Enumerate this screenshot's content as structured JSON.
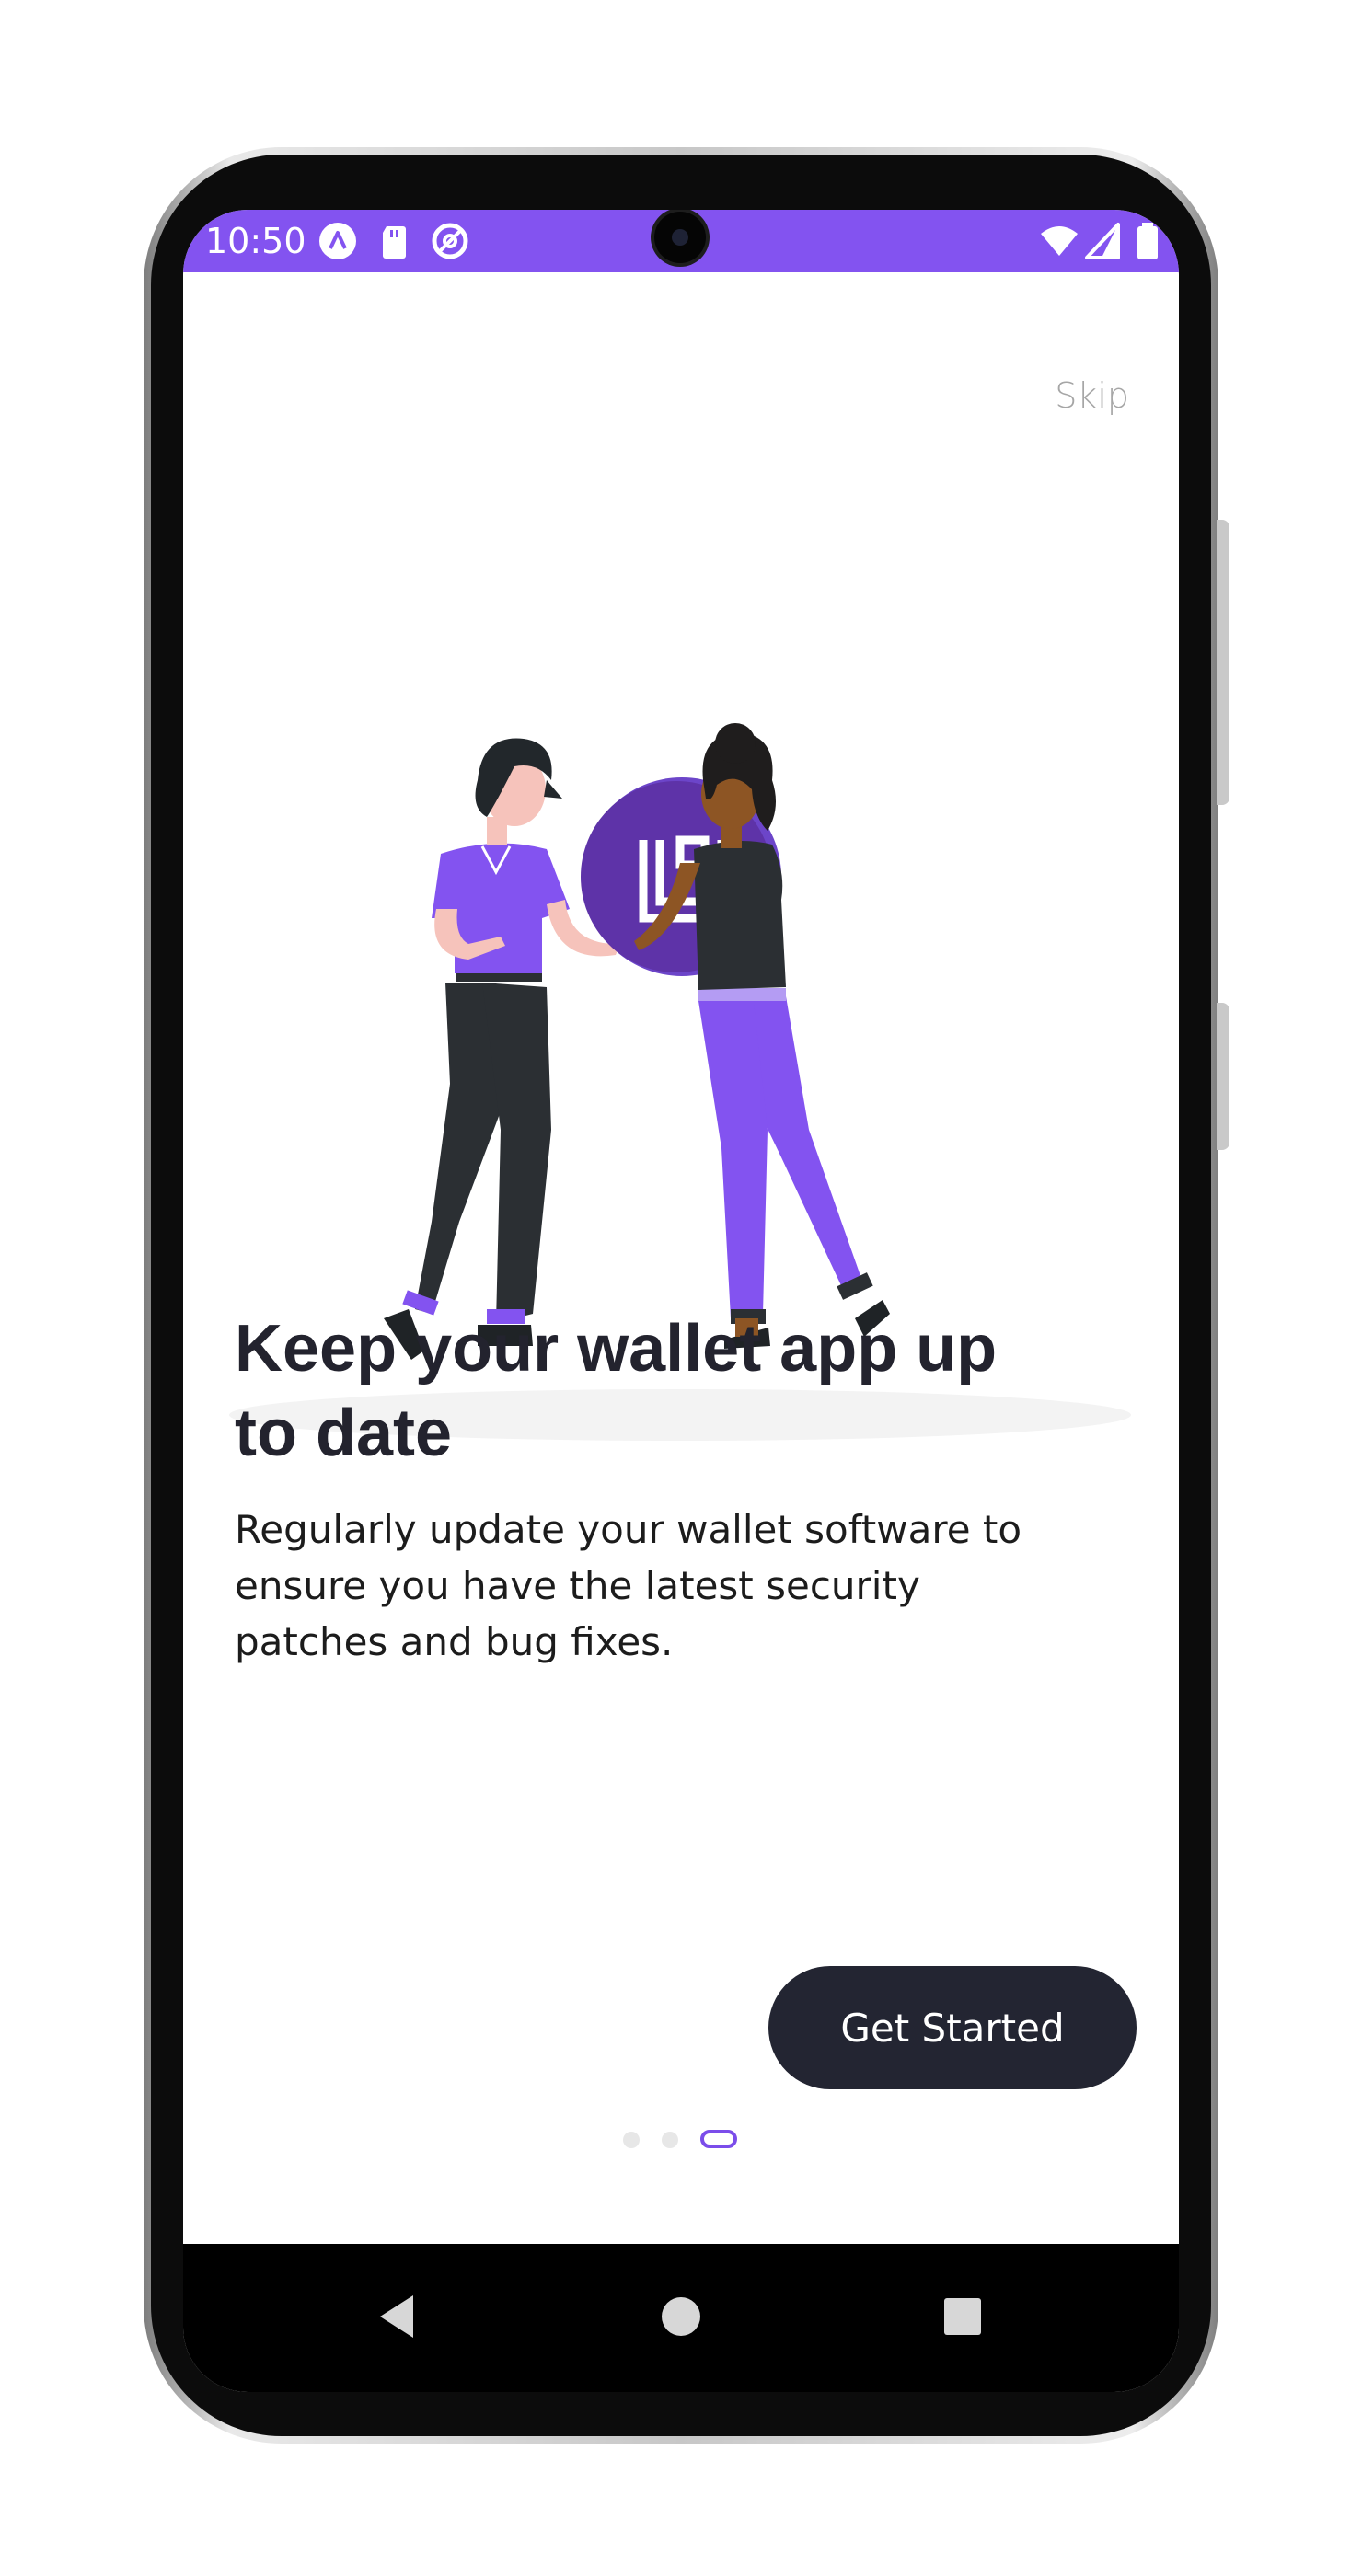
{
  "status_bar": {
    "time": "10:50",
    "left_icons": [
      "launcher-icon",
      "sd-card-icon",
      "at-sign-icon"
    ],
    "right_icons": [
      "wifi-icon",
      "signal-icon",
      "battery-icon"
    ],
    "color": "#8353f0"
  },
  "onboarding": {
    "skip_label": "Skip",
    "illustration_icon": "wallet-logo-icon",
    "title": "Keep your wallet app up to date",
    "description": "Regularly update your wallet software to ensure you have the latest security patches and bug fixes.",
    "cta_label": "Get Started",
    "pager": {
      "current": 3,
      "total": 3
    },
    "colors": {
      "accent": "#7b4dea",
      "button": "#232532",
      "title": "#23232e"
    }
  },
  "nav_bar": {
    "buttons": [
      "back-icon",
      "home-icon",
      "recents-icon"
    ]
  }
}
